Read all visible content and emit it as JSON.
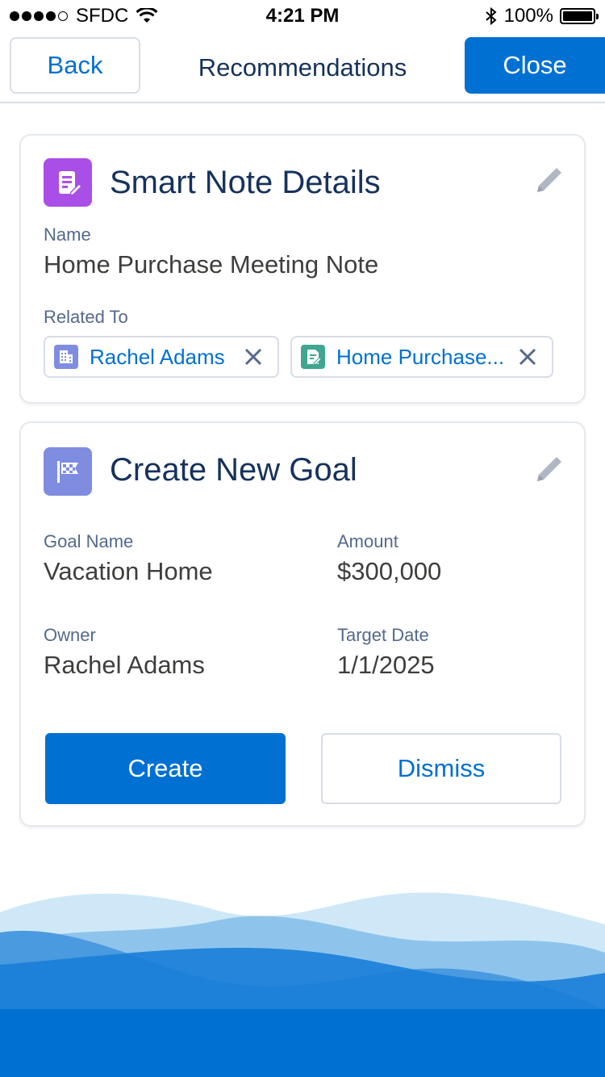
{
  "status_bar": {
    "carrier": "SFDC",
    "time": "4:21 PM",
    "battery": "100%"
  },
  "nav": {
    "back_label": "Back",
    "title": "Recommendations",
    "close_label": "Close"
  },
  "smart_note": {
    "title": "Smart Note Details",
    "name_label": "Name",
    "name_value": "Home Purchase Meeting Note",
    "related_label": "Related To",
    "related": [
      {
        "label": "Rachel Adams",
        "icon": "account-icon"
      },
      {
        "label": "Home Purchase...",
        "icon": "note-icon"
      }
    ]
  },
  "goal": {
    "title": "Create New Goal",
    "goal_name_label": "Goal Name",
    "goal_name_value": "Vacation Home",
    "amount_label": "Amount",
    "amount_value": "$300,000",
    "owner_label": "Owner",
    "owner_value": "Rachel Adams",
    "target_date_label": "Target Date",
    "target_date_value": "1/1/2025",
    "create_label": "Create",
    "dismiss_label": "Dismiss"
  },
  "colors": {
    "brand": "#0070d2",
    "note_icon_bg": "#a94ee6",
    "goal_icon_bg": "#7f8de1",
    "account_icon_bg": "#7f8de1",
    "doc_icon_bg": "#3fa790"
  }
}
